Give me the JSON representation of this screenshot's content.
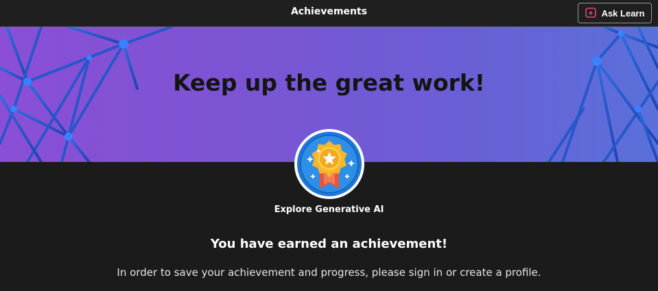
{
  "header": {
    "title": "Achievements"
  },
  "ask_learn": {
    "label": "Ask Learn"
  },
  "hero": {
    "heading": "Keep up the great work!"
  },
  "achievement": {
    "badge_icon": "award-medal-icon",
    "name": "Explore Generative AI"
  },
  "message": {
    "title": "You have earned an achievement!",
    "body": "In order to save your achievement and progress, please sign in or create a profile."
  },
  "colors": {
    "background": "#1b1b1b",
    "hero_gradient_start": "#8a4fd6",
    "hero_gradient_end": "#5a70da",
    "badge_ring": "#1f7ad6"
  }
}
